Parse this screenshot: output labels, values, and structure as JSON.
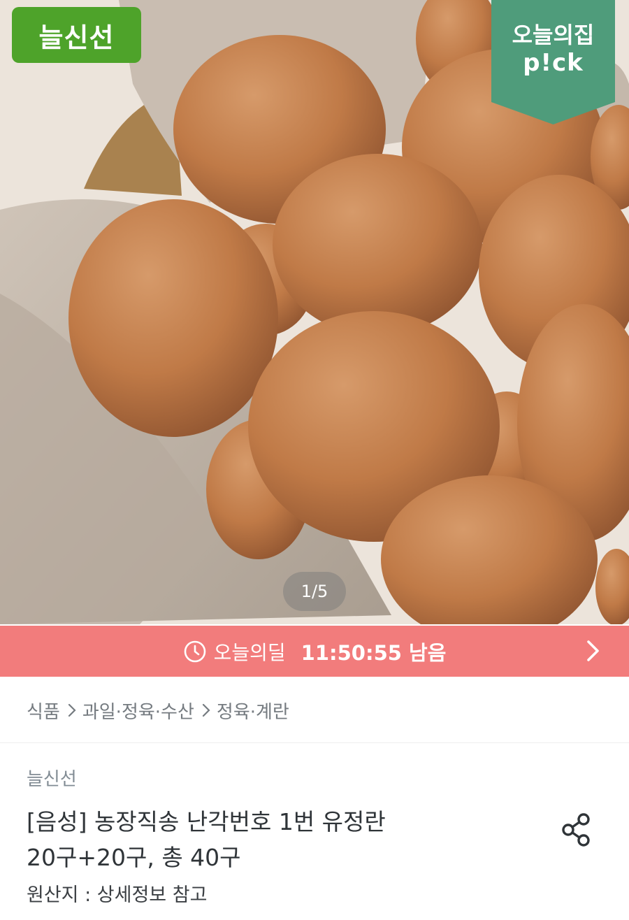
{
  "hero": {
    "brand_badge": "늘신선",
    "pick_line1": "오늘의집",
    "pick_line2": "p!ck",
    "page_indicator": "1/5"
  },
  "deal": {
    "label": "오늘의딜",
    "time_remaining": "11:50:55 남음",
    "color": "#f27c7c"
  },
  "breadcrumb": {
    "items": [
      "식품",
      "과일·정육·수산",
      "정육·계란"
    ]
  },
  "product": {
    "seller": "늘신선",
    "title_line1": "[음성] 농장직송 난각번호 1번 유정란",
    "title_line2": "20구+20구, 총 40구",
    "origin": "원산지 : 상세정보 참고"
  },
  "colors": {
    "brand_badge": "#4ea32a",
    "pick_badge": "#4f9c7b"
  },
  "icons": [
    "clock-icon",
    "chevron-right-icon",
    "share-icon"
  ]
}
